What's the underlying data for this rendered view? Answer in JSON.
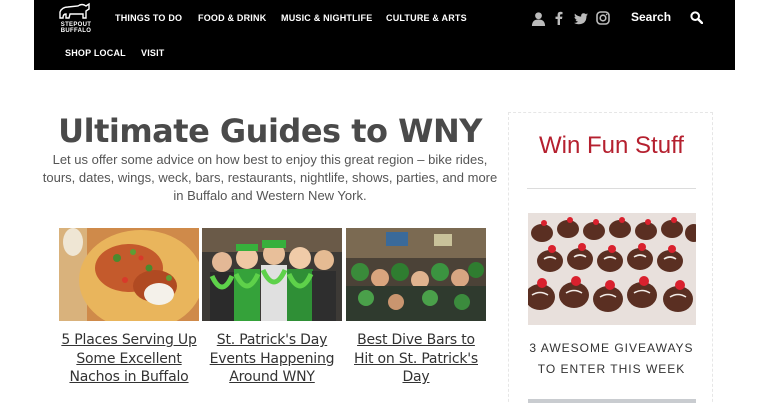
{
  "brand": {
    "logo_line1": "STEPOUT",
    "logo_line2": "BUFFALO"
  },
  "nav": {
    "items": [
      "THINGS TO DO",
      "FOOD & DRINK",
      "MUSIC & NIGHTLIFE",
      "CULTURE & ARTS",
      "SHOP LOCAL",
      "VISIT"
    ],
    "search_label": "Search",
    "icons": [
      "user-icon",
      "facebook-icon",
      "twitter-icon",
      "instagram-icon",
      "search-icon"
    ]
  },
  "main": {
    "title": "Ultimate Guides to WNY",
    "intro": "Let us offer some advice on how best to enjoy this great region – bike rides, tours, dates, wings, weck, bars, restaurants, nightlife, shows, parties, and more in Buffalo and Western New York.",
    "cards": [
      {
        "title": "5 Places Serving Up Some Excellent Nachos in Buffalo"
      },
      {
        "title": "St. Patrick's Day Events Happening Around WNY"
      },
      {
        "title": "Best Dive Bars to Hit on St. Patrick's Day"
      }
    ]
  },
  "sidebar": {
    "heading": "Win Fun Stuff",
    "link": "3 AWESOME GIVEAWAYS TO ENTER THIS WEEK"
  },
  "colors": {
    "nav_bg": "#000000",
    "accent_red": "#b5202f",
    "text": "#333333"
  }
}
